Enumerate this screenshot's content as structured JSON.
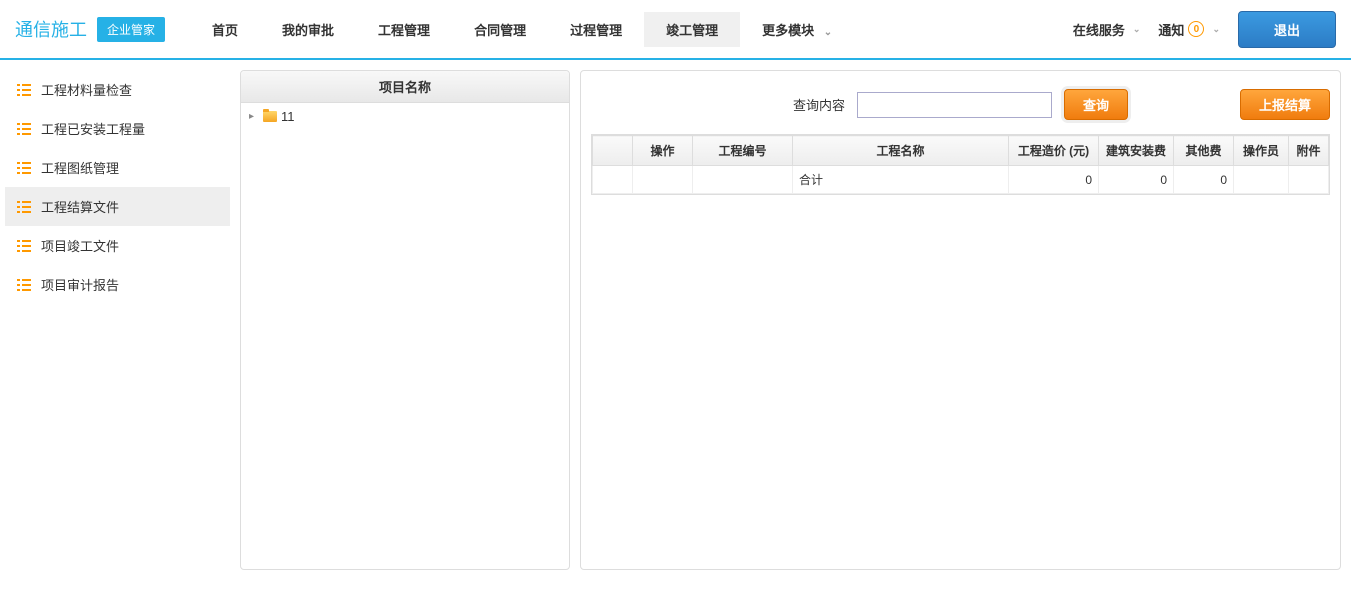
{
  "header": {
    "logo": "通信施工",
    "company_badge": "企业管家",
    "nav": [
      {
        "label": "首页"
      },
      {
        "label": "我的审批"
      },
      {
        "label": "工程管理"
      },
      {
        "label": "合同管理"
      },
      {
        "label": "过程管理"
      },
      {
        "label": "竣工管理",
        "active": true
      },
      {
        "label": "更多模块",
        "dropdown": true
      }
    ],
    "right": {
      "online_service": "在线服务",
      "notification": "通知",
      "notification_count": "0",
      "exit": "退出"
    }
  },
  "sidebar": {
    "items": [
      {
        "label": "工程材料量检查"
      },
      {
        "label": "工程已安装工程量"
      },
      {
        "label": "工程图纸管理"
      },
      {
        "label": "工程结算文件",
        "selected": true
      },
      {
        "label": "项目竣工文件"
      },
      {
        "label": "项目审计报告"
      }
    ]
  },
  "tree": {
    "header": "项目名称",
    "nodes": [
      {
        "label": "11"
      }
    ]
  },
  "search": {
    "label": "查询内容",
    "query_btn": "查询",
    "report_btn": "上报结算",
    "input_value": ""
  },
  "grid": {
    "columns": [
      "",
      "操作",
      "工程编号",
      "工程名称",
      "工程造价 (元)",
      "建筑安装费",
      "其他费",
      "操作员",
      "附件"
    ],
    "rows": [
      {
        "c0": "",
        "c1": "",
        "c2": "",
        "c3": "合计",
        "c4": "0",
        "c5": "0",
        "c6": "0",
        "c7": "",
        "c8": ""
      }
    ]
  }
}
